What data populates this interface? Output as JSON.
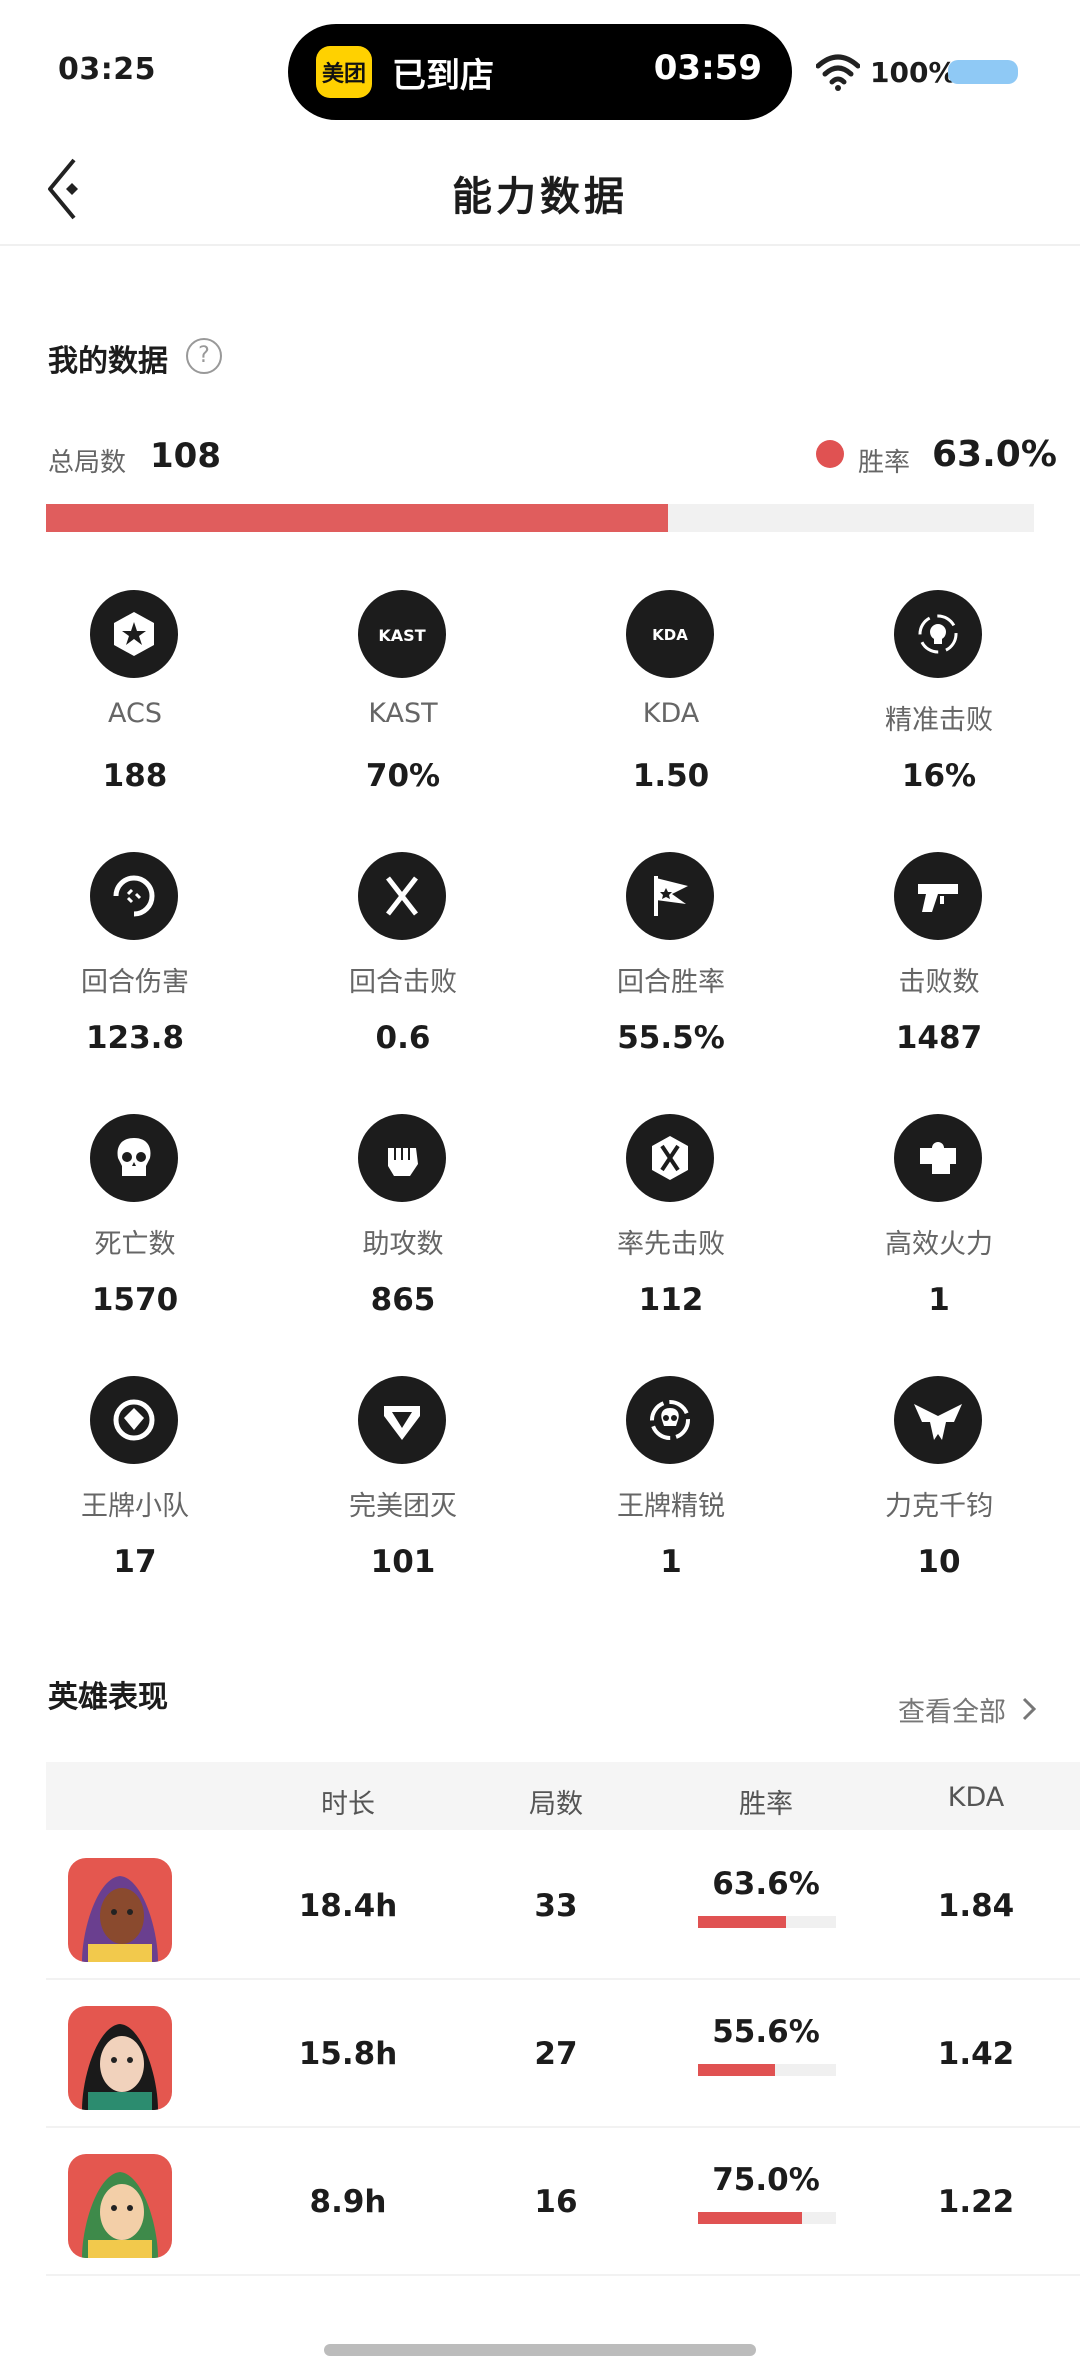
{
  "status_bar": {
    "time": "03:25",
    "island_app_icon_text": "美团",
    "island_text": "已到店",
    "island_time": "03:59",
    "battery": "100%"
  },
  "nav": {
    "title": "能力数据"
  },
  "my_data": {
    "title": "我的数据",
    "help": "?",
    "total_games_label": "总局数",
    "total_games": "108",
    "win_rate_label": "胜率",
    "win_rate": "63.0%",
    "win_rate_fraction": 0.63
  },
  "stats": [
    {
      "icon": "acs-star-icon",
      "label": "ACS",
      "value": "188"
    },
    {
      "icon": "kast-icon",
      "label": "KAST",
      "value": "70%"
    },
    {
      "icon": "kda-icon",
      "label": "KDA",
      "value": "1.50"
    },
    {
      "icon": "headshot-crosshair-icon",
      "label": "精准击败",
      "value": "16%"
    },
    {
      "icon": "round-damage-icon",
      "label": "回合伤害",
      "value": "123.8"
    },
    {
      "icon": "round-kill-blades-icon",
      "label": "回合击败",
      "value": "0.6"
    },
    {
      "icon": "round-win-flag-icon",
      "label": "回合胜率",
      "value": "55.5%"
    },
    {
      "icon": "gun-icon",
      "label": "击败数",
      "value": "1487"
    },
    {
      "icon": "skull-icon",
      "label": "死亡数",
      "value": "1570"
    },
    {
      "icon": "fist-icon",
      "label": "助攻数",
      "value": "865"
    },
    {
      "icon": "first-blood-icon",
      "label": "率先击败",
      "value": "112"
    },
    {
      "icon": "puzzle-icon",
      "label": "高效火力",
      "value": "1"
    },
    {
      "icon": "ace-squad-icon",
      "label": "王牌小队",
      "value": "17"
    },
    {
      "icon": "diamond-shield-icon",
      "label": "完美团灭",
      "value": "101"
    },
    {
      "icon": "ace-elite-icon",
      "label": "王牌精锐",
      "value": "1"
    },
    {
      "icon": "eagle-icon",
      "label": "力克千钧",
      "value": "10"
    }
  ],
  "heroes": {
    "title": "英雄表现",
    "view_all": "查看全部",
    "columns": [
      "时长",
      "局数",
      "胜率",
      "KDA"
    ],
    "rows": [
      {
        "duration": "18.4h",
        "games": "33",
        "win_rate": "63.6%",
        "win_fraction": 0.636,
        "kda": "1.84"
      },
      {
        "duration": "15.8h",
        "games": "27",
        "win_rate": "55.6%",
        "win_fraction": 0.556,
        "kda": "1.42"
      },
      {
        "duration": "8.9h",
        "games": "16",
        "win_rate": "75.0%",
        "win_fraction": 0.75,
        "kda": "1.22"
      }
    ]
  }
}
